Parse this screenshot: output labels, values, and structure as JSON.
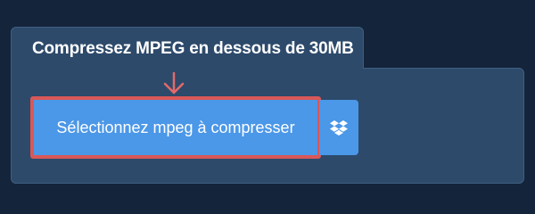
{
  "panel": {
    "title": "Compressez MPEG en dessous de 30MB"
  },
  "upload": {
    "label": "Sélectionnez mpeg à compresser",
    "highlight_color": "#d95858",
    "button_color": "#4b97e8"
  },
  "icons": {
    "arrow": "arrow-down-icon",
    "dropbox": "dropbox-icon"
  },
  "colors": {
    "background": "#14243a",
    "panel": "#2d4a6b",
    "panel_border": "#3f5f82"
  }
}
